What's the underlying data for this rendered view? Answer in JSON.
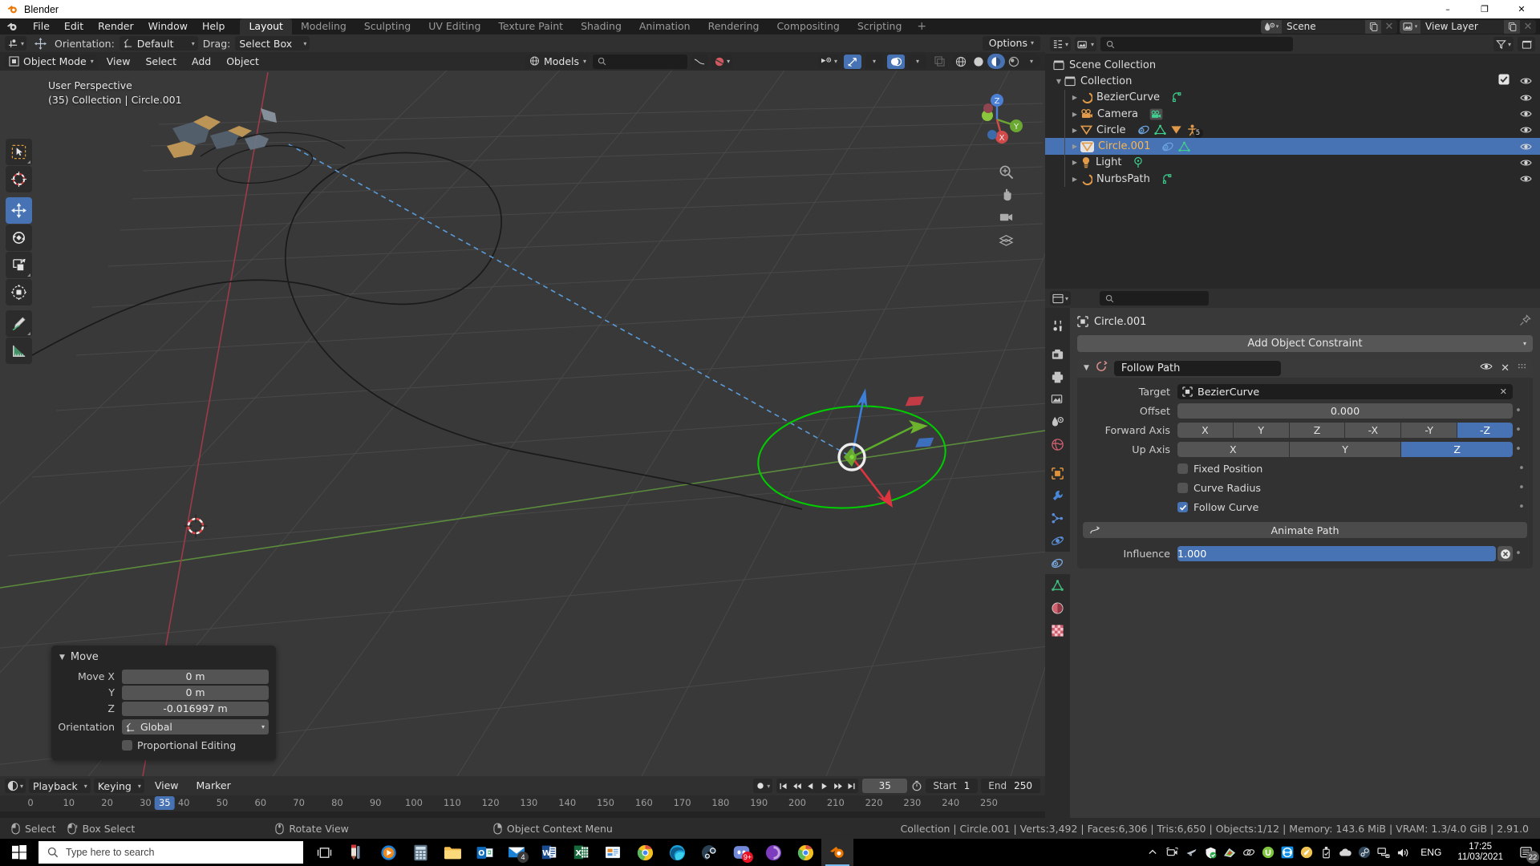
{
  "window": {
    "title": "Blender",
    "minimize": "–",
    "maximize": "❐",
    "close": "✕"
  },
  "topbar": {
    "menus": [
      "File",
      "Edit",
      "Render",
      "Window",
      "Help"
    ],
    "workspaces": [
      {
        "label": "Layout",
        "active": true
      },
      {
        "label": "Modeling",
        "active": false
      },
      {
        "label": "Sculpting",
        "active": false
      },
      {
        "label": "UV Editing",
        "active": false
      },
      {
        "label": "Texture Paint",
        "active": false
      },
      {
        "label": "Shading",
        "active": false
      },
      {
        "label": "Animation",
        "active": false
      },
      {
        "label": "Rendering",
        "active": false
      },
      {
        "label": "Compositing",
        "active": false
      },
      {
        "label": "Scripting",
        "active": false
      }
    ],
    "add_workspace": "+",
    "scene_name": "Scene",
    "view_layer_name": "View Layer"
  },
  "tool_header": {
    "orientation_label": "Orientation:",
    "orientation_value": "Default",
    "drag_label": "Drag:",
    "drag_value": "Select Box",
    "transform_orientation": "Global",
    "options_label": "Options"
  },
  "viewport": {
    "mode": "Object Mode",
    "menus": [
      "View",
      "Select",
      "Add",
      "Object"
    ],
    "asset_library": "Models",
    "search_placeholder": "",
    "overlay_line1": "User Perspective",
    "overlay_line2": "(35) Collection | Circle.001",
    "gizmo_axes": {
      "x": "X",
      "y": "Y",
      "z": "Z"
    },
    "tools": [
      "tweak-select-tool",
      "cursor-tool",
      "move-tool",
      "rotate-tool",
      "scale-tool",
      "transform-tool",
      "annotate-tool",
      "measure-tool"
    ],
    "active_tool": "move-tool"
  },
  "operator_panel": {
    "title": "Move",
    "rows": [
      {
        "label": "Move X",
        "value": "0 m"
      },
      {
        "label": "Y",
        "value": "0 m"
      },
      {
        "label": "Z",
        "value": "-0.016997 m"
      }
    ],
    "orientation_label": "Orientation",
    "orientation_value": "Global",
    "proportional_label": "Proportional Editing",
    "proportional_checked": false
  },
  "timeline": {
    "menus": [
      "Playback",
      "Keying",
      "View",
      "Marker"
    ],
    "current_frame": "35",
    "start_label": "Start",
    "start_value": "1",
    "end_label": "End",
    "end_value": "250",
    "ticks": [
      0,
      10,
      20,
      30,
      40,
      50,
      60,
      70,
      80,
      90,
      100,
      110,
      120,
      130,
      140,
      150,
      160,
      170,
      180,
      190,
      200,
      210,
      220,
      230,
      240,
      250
    ],
    "playhead_frame": 35
  },
  "outliner": {
    "root": "Scene Collection",
    "items": [
      {
        "name": "Collection",
        "indent": 1,
        "icon": "collection-icon",
        "disclosure": "▼",
        "selected": false,
        "checkbox": true,
        "badges": []
      },
      {
        "name": "BezierCurve",
        "indent": 2,
        "icon": "curve-icon",
        "disclosure": "▶",
        "selected": false,
        "checkbox": false,
        "badges": [
          "curve-data-icon"
        ]
      },
      {
        "name": "Camera",
        "indent": 2,
        "icon": "camera-icon",
        "disclosure": "▶",
        "selected": false,
        "checkbox": false,
        "badges": [
          "camera-data-icon"
        ]
      },
      {
        "name": "Circle",
        "indent": 2,
        "icon": "mesh-icon",
        "disclosure": "▶",
        "selected": false,
        "checkbox": false,
        "badges": [
          "constraint-icon",
          "mesh-data-icon",
          "modifier-icon",
          "pose-icon"
        ],
        "badge_count": "5"
      },
      {
        "name": "Circle.001",
        "indent": 2,
        "icon": "mesh-icon",
        "disclosure": "▶",
        "selected": true,
        "checkbox": false,
        "badges": [
          "constraint-icon",
          "mesh-data-icon"
        ]
      },
      {
        "name": "Light",
        "indent": 2,
        "icon": "light-icon",
        "disclosure": "▶",
        "selected": false,
        "checkbox": false,
        "badges": [
          "light-data-icon"
        ]
      },
      {
        "name": "NurbsPath",
        "indent": 2,
        "icon": "curve-icon",
        "disclosure": "▶",
        "selected": false,
        "checkbox": false,
        "badges": [
          "curve-data-icon"
        ]
      }
    ]
  },
  "properties": {
    "breadcrumb_object": "Circle.001",
    "add_constraint_label": "Add Object Constraint",
    "constraint": {
      "name": "Follow Path",
      "target_label": "Target",
      "target_value": "BezierCurve",
      "offset_label": "Offset",
      "offset_value": "0.000",
      "forward_axis_label": "Forward Axis",
      "forward_axis_options": [
        "X",
        "Y",
        "Z",
        "-X",
        "-Y",
        "-Z"
      ],
      "forward_axis_selected": "-Z",
      "up_axis_label": "Up Axis",
      "up_axis_options": [
        "X",
        "Y",
        "Z"
      ],
      "up_axis_selected": "Z",
      "fixed_position_label": "Fixed Position",
      "fixed_position_checked": false,
      "curve_radius_label": "Curve Radius",
      "curve_radius_checked": false,
      "follow_curve_label": "Follow Curve",
      "follow_curve_checked": true,
      "animate_path_label": "Animate Path",
      "influence_label": "Influence",
      "influence_value": "1.000",
      "influence_percent": 100
    },
    "tabs": [
      "tool-tab",
      "render-tab",
      "output-tab",
      "view-layer-tab",
      "scene-tab",
      "world-tab",
      "object-tab",
      "modifier-tab",
      "particles-tab",
      "physics-tab",
      "constraint-tab",
      "data-tab",
      "material-tab",
      "texture-tab"
    ],
    "active_tab": "constraint-tab"
  },
  "statusbar": {
    "hints": [
      {
        "icon": "mouse-left-icon",
        "label": "Select"
      },
      {
        "icon": "mouse-left-drag-icon",
        "label": "Box Select"
      },
      {
        "icon": "mouse-middle-icon",
        "label": "Rotate View"
      },
      {
        "icon": "mouse-right-icon",
        "label": "Object Context Menu"
      }
    ],
    "stats": "Collection | Circle.001 | Verts:3,492 | Faces:6,306 | Tris:6,650 | Objects:1/12 | Memory: 143.6 MiB | VRAM: 1.3/4.0 GiB | 2.91.0"
  },
  "taskbar": {
    "search_placeholder": "Type here to search",
    "apps": [
      {
        "name": "task-view-icon",
        "badge": null,
        "active": false
      },
      {
        "name": "paint-3d-icon",
        "badge": null,
        "active": false
      },
      {
        "name": "media-player-icon",
        "badge": null,
        "active": false
      },
      {
        "name": "calculator-icon",
        "badge": null,
        "active": false
      },
      {
        "name": "file-explorer-icon",
        "badge": null,
        "active": false
      },
      {
        "name": "outlook-icon",
        "badge": null,
        "active": false
      },
      {
        "name": "mail-icon",
        "badge": "4",
        "active": false
      },
      {
        "name": "word-icon",
        "badge": null,
        "active": false
      },
      {
        "name": "excel-icon",
        "badge": null,
        "active": false
      },
      {
        "name": "powerpoint-icon",
        "badge": null,
        "active": false
      },
      {
        "name": "chrome-icon",
        "badge": null,
        "active": false
      },
      {
        "name": "edge-icon",
        "badge": null,
        "active": false
      },
      {
        "name": "steam-icon",
        "badge": null,
        "active": false
      },
      {
        "name": "discord-icon",
        "badge": "9+",
        "active": false
      },
      {
        "name": "tor-browser-icon",
        "badge": null,
        "active": false
      },
      {
        "name": "chrome-canary-icon",
        "badge": null,
        "active": false
      },
      {
        "name": "blender-icon",
        "badge": null,
        "active": true
      }
    ],
    "tray_lang": "ENG",
    "tray_time": "17:25",
    "tray_date": "11/03/2021",
    "tray_notif_count": "22"
  },
  "colors": {
    "accent_blue": "#4772b3",
    "orange": "#ed9a3a",
    "select_orange": "#ffb64d",
    "header_bg": "#303030",
    "panel_bg": "#393939",
    "field_bg": "#545454",
    "viewport_bg": "#393939",
    "axis_x_red": "#e04040",
    "axis_y_green": "#46c046",
    "axis_z_blue": "#4287e0",
    "curve_selected_green": "#00d000"
  }
}
